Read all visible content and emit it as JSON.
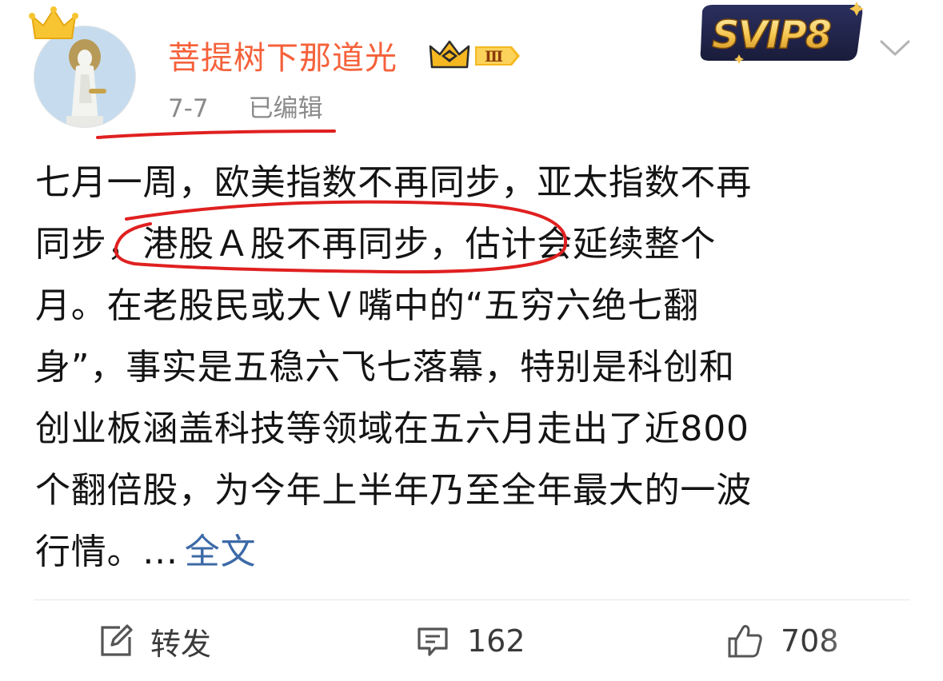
{
  "author": {
    "name": "菩提树下那道光",
    "vip_level": "Ⅲ",
    "svip_badge": "SVIP8"
  },
  "meta": {
    "date": "7-7",
    "edited": "已编辑"
  },
  "post": {
    "lines": [
      "七月一周，欧美指数不再同步，亚太指数不再",
      "同步，港股Ａ股不再同步，估计会延续整个",
      "月。在老股民或大Ｖ嘴中的“五穷六绝七翻",
      "身”，事实是五稳六飞七落幕，特别是科创和",
      "创业板涵盖科技等领域在五六月走出了近800",
      "个翻倍股，为今年上半年乃至全年最大的一波"
    ],
    "last_line": "行情。...",
    "more_link": "全文"
  },
  "actions": {
    "repost_label": "转发",
    "comment_count": "162",
    "like_count": "708"
  },
  "icons": {
    "repost": "edit-icon",
    "comment": "comment-icon",
    "like": "thumbs-up-icon",
    "chevron": "chevron-down-icon"
  },
  "colors": {
    "username": "#f5613a",
    "link": "#3d6aa7",
    "meta": "#8b8b8b",
    "annotation": "#e02020"
  }
}
